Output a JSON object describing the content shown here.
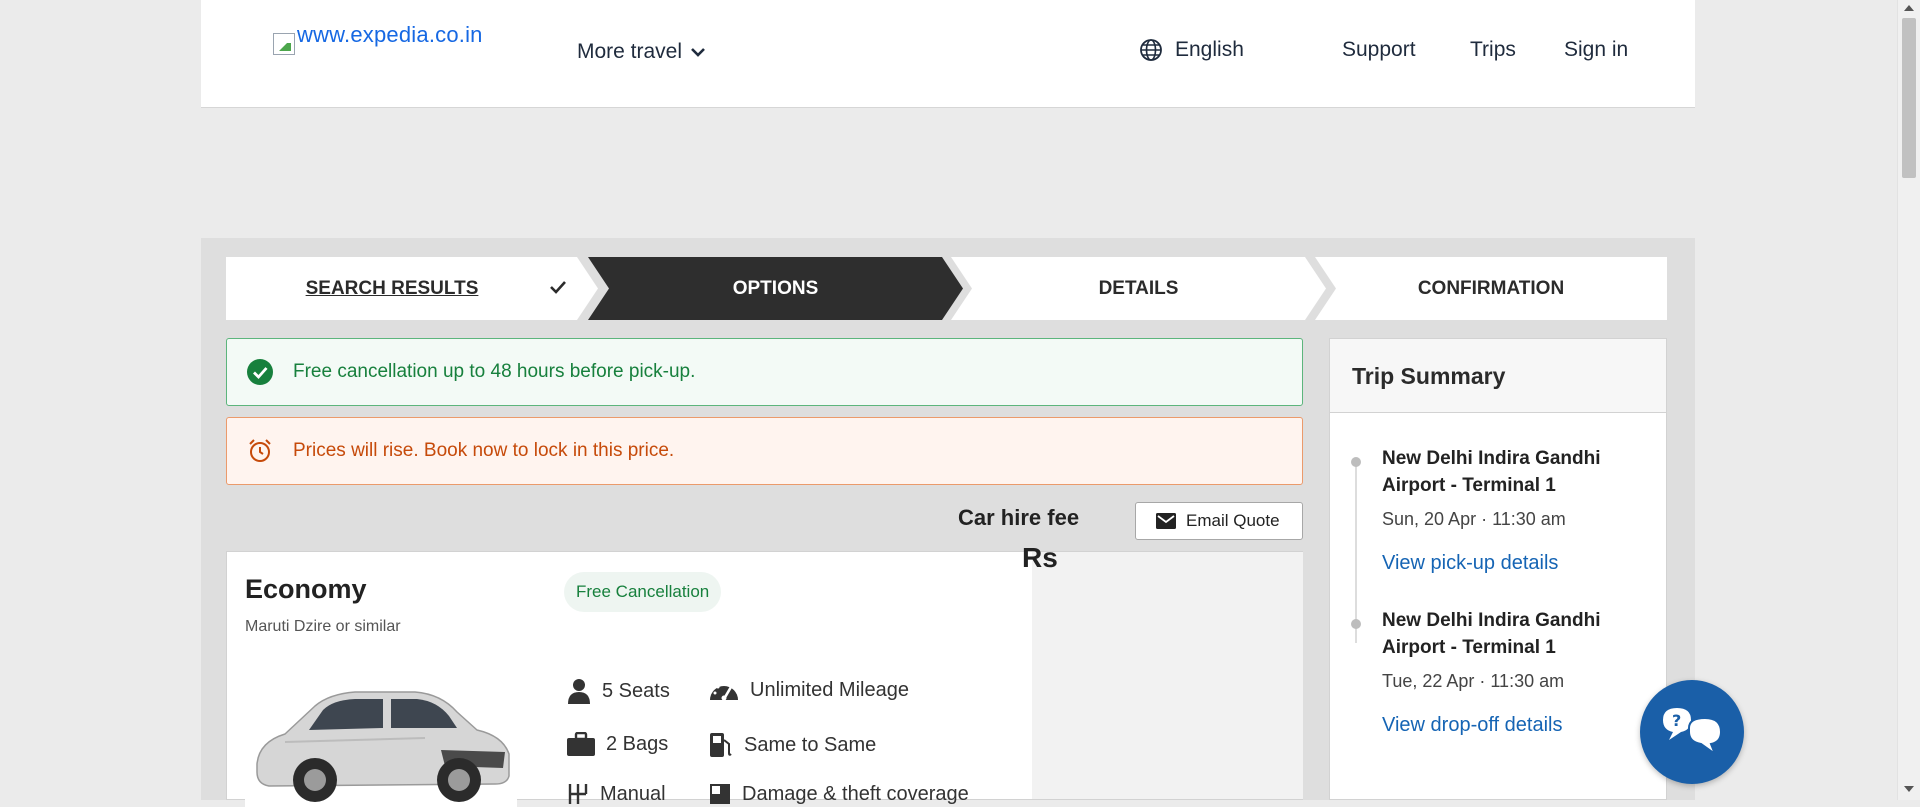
{
  "header": {
    "logo_alt": "www.expedia.co.in",
    "more_travel": "More travel",
    "language": "English",
    "support": "Support",
    "trips": "Trips",
    "sign_in": "Sign in"
  },
  "stepper": {
    "steps": [
      {
        "label": "SEARCH RESULTS",
        "state": "completed"
      },
      {
        "label": "OPTIONS",
        "state": "active"
      },
      {
        "label": "DETAILS",
        "state": "upcoming"
      },
      {
        "label": "CONFIRMATION",
        "state": "upcoming"
      }
    ]
  },
  "alerts": {
    "cancellation": "Free cancellation up to 48 hours before pick-up.",
    "price_rise": "Prices will rise. Book now to lock in this price."
  },
  "email_quote": "Email Quote",
  "car": {
    "class": "Economy",
    "model": "Maruti Dzire or similar",
    "badge": "Free Cancellation",
    "features": {
      "seats": "5 Seats",
      "mileage": "Unlimited Mileage",
      "bags": "2 Bags",
      "fuel": "Same to Same",
      "transmission": "Manual",
      "damage": "Damage & theft coverage"
    },
    "price_label": "Car hire fee",
    "price_value": "Rs"
  },
  "trip_summary": {
    "title": "Trip Summary",
    "pickup": {
      "place": "New Delhi Indira Gandhi Airport - Terminal 1",
      "datetime": "Sun, 20 Apr · 11:30 am",
      "link": "View pick-up details"
    },
    "dropoff": {
      "place": "New Delhi Indira Gandhi Airport - Terminal 1",
      "datetime": "Tue, 22 Apr · 11:30 am",
      "link": "View drop-off details"
    }
  },
  "colors": {
    "active_step": "#2b2b2b",
    "link": "#1564b4",
    "success": "#17803d",
    "warning": "#c64a0a",
    "chat": "#1a5fa8"
  }
}
